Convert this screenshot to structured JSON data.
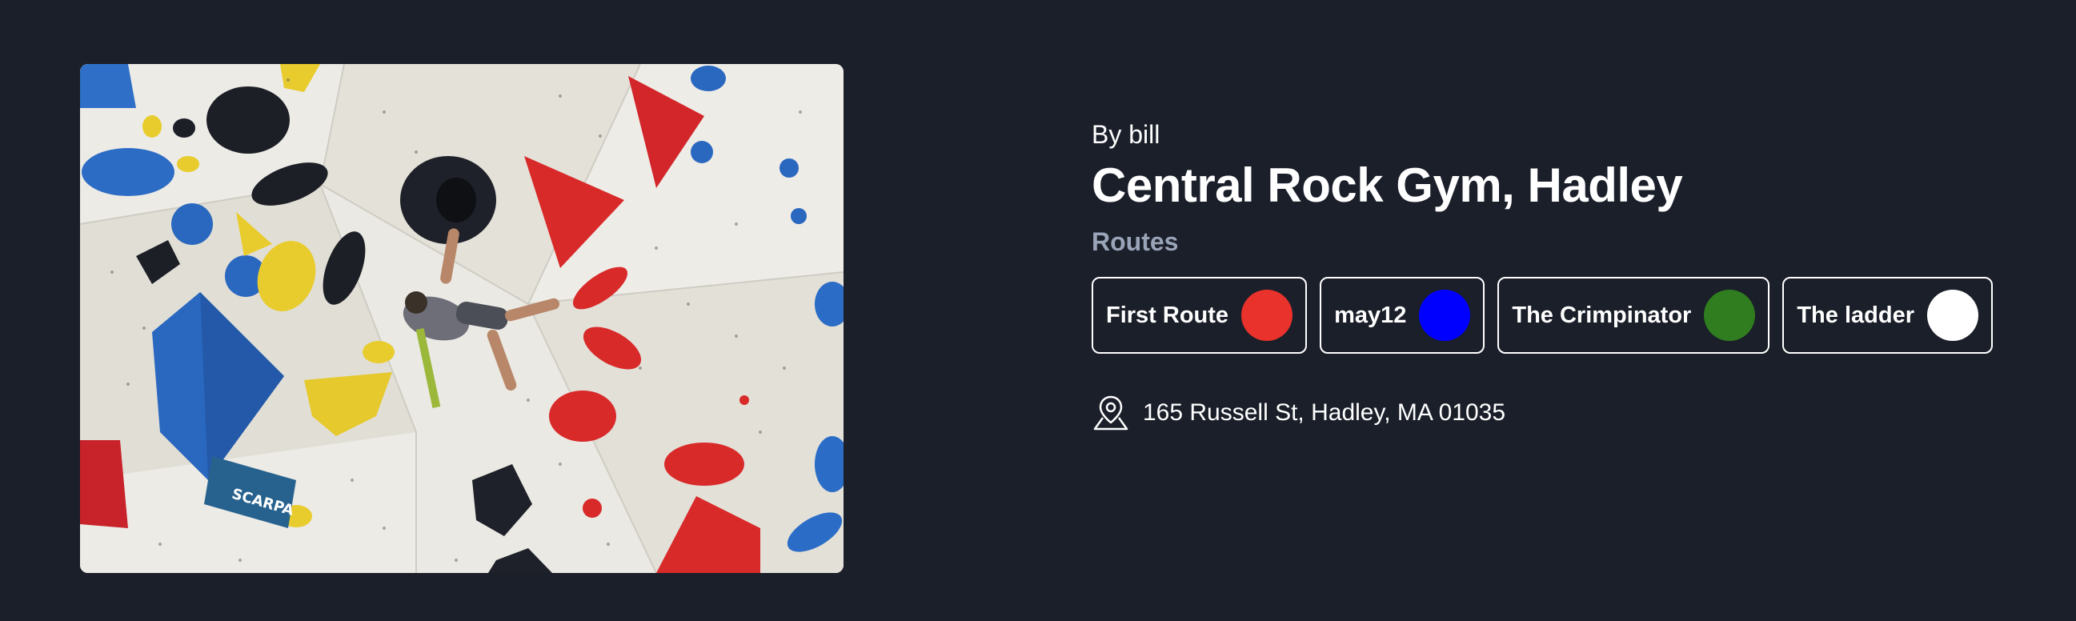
{
  "gym": {
    "author": "By bill",
    "name": "Central Rock Gym, Hadley",
    "routes_heading": "Routes",
    "address": "165 Russell St, Hadley, MA 01035",
    "address_icon": "map-pin-icon",
    "photo_banner_text": "SCARPA"
  },
  "routes": [
    {
      "name": "First Route",
      "color": "#e8322b"
    },
    {
      "name": "may12",
      "color": "#0000ff"
    },
    {
      "name": "The Crimpinator",
      "color": "#2f7d1f"
    },
    {
      "name": "The ladder",
      "color": "#ffffff"
    }
  ]
}
